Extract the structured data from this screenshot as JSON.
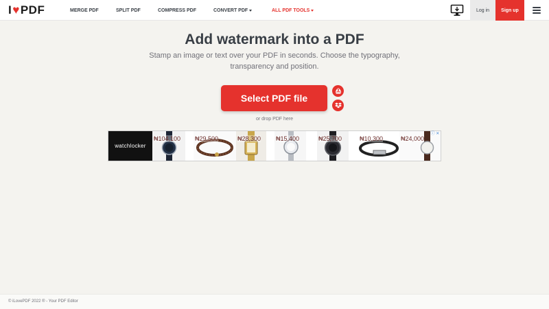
{
  "header": {
    "logo": {
      "prefix": "I",
      "suffix": "PDF"
    },
    "nav": [
      {
        "label": "MERGE PDF"
      },
      {
        "label": "SPLIT PDF"
      },
      {
        "label": "COMPRESS PDF"
      },
      {
        "label": "CONVERT PDF"
      },
      {
        "label": "ALL PDF TOOLS"
      }
    ],
    "login_label": "Log in",
    "signup_label": "Sign up"
  },
  "main": {
    "title": "Add watermark into a PDF",
    "subtitle": "Stamp an image or text over your PDF in seconds. Choose the typography, transparency and position.",
    "select_button": "Select PDF file",
    "drop_text": "or drop PDF here"
  },
  "ad": {
    "brand": "watchlocker",
    "info": "ⓘ ✕",
    "prices": [
      "₦104,100",
      "₦29,500",
      "₦28,300",
      "₦15,400",
      "₦25,700",
      "₦10,300",
      "₦24,000"
    ]
  },
  "footer": {
    "text": "© iLovePDF 2022 ® - Your PDF Editor"
  },
  "colors": {
    "brand_red": "#e5322d",
    "background": "#f4f3ef",
    "text": "#383e45"
  }
}
